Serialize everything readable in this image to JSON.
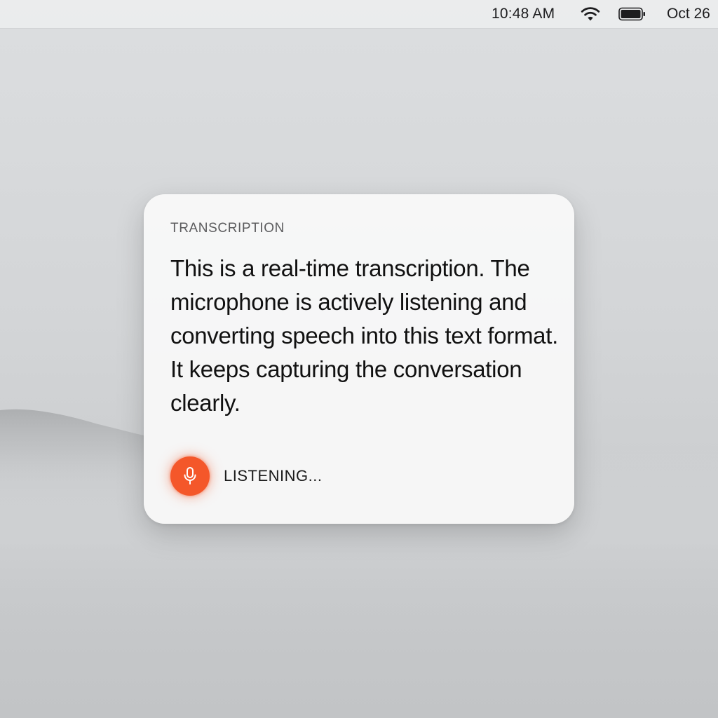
{
  "menubar": {
    "time": "10:48 AM",
    "date": "Oct 26",
    "wifi_icon": "wifi-icon",
    "battery_icon": "battery-icon"
  },
  "widget": {
    "heading": "TRANSCRIPTION",
    "transcript": "This is a real-time transcription. The microphone is actively listening and converting speech into this text format. It keeps capturing the conversation clearly.",
    "mic_icon": "microphone-icon",
    "status": "LISTENING..."
  },
  "colors": {
    "accent": "#f4572a",
    "panel_bg": "#f7f7f7",
    "text": "#111111",
    "muted": "#5c5c5e"
  }
}
